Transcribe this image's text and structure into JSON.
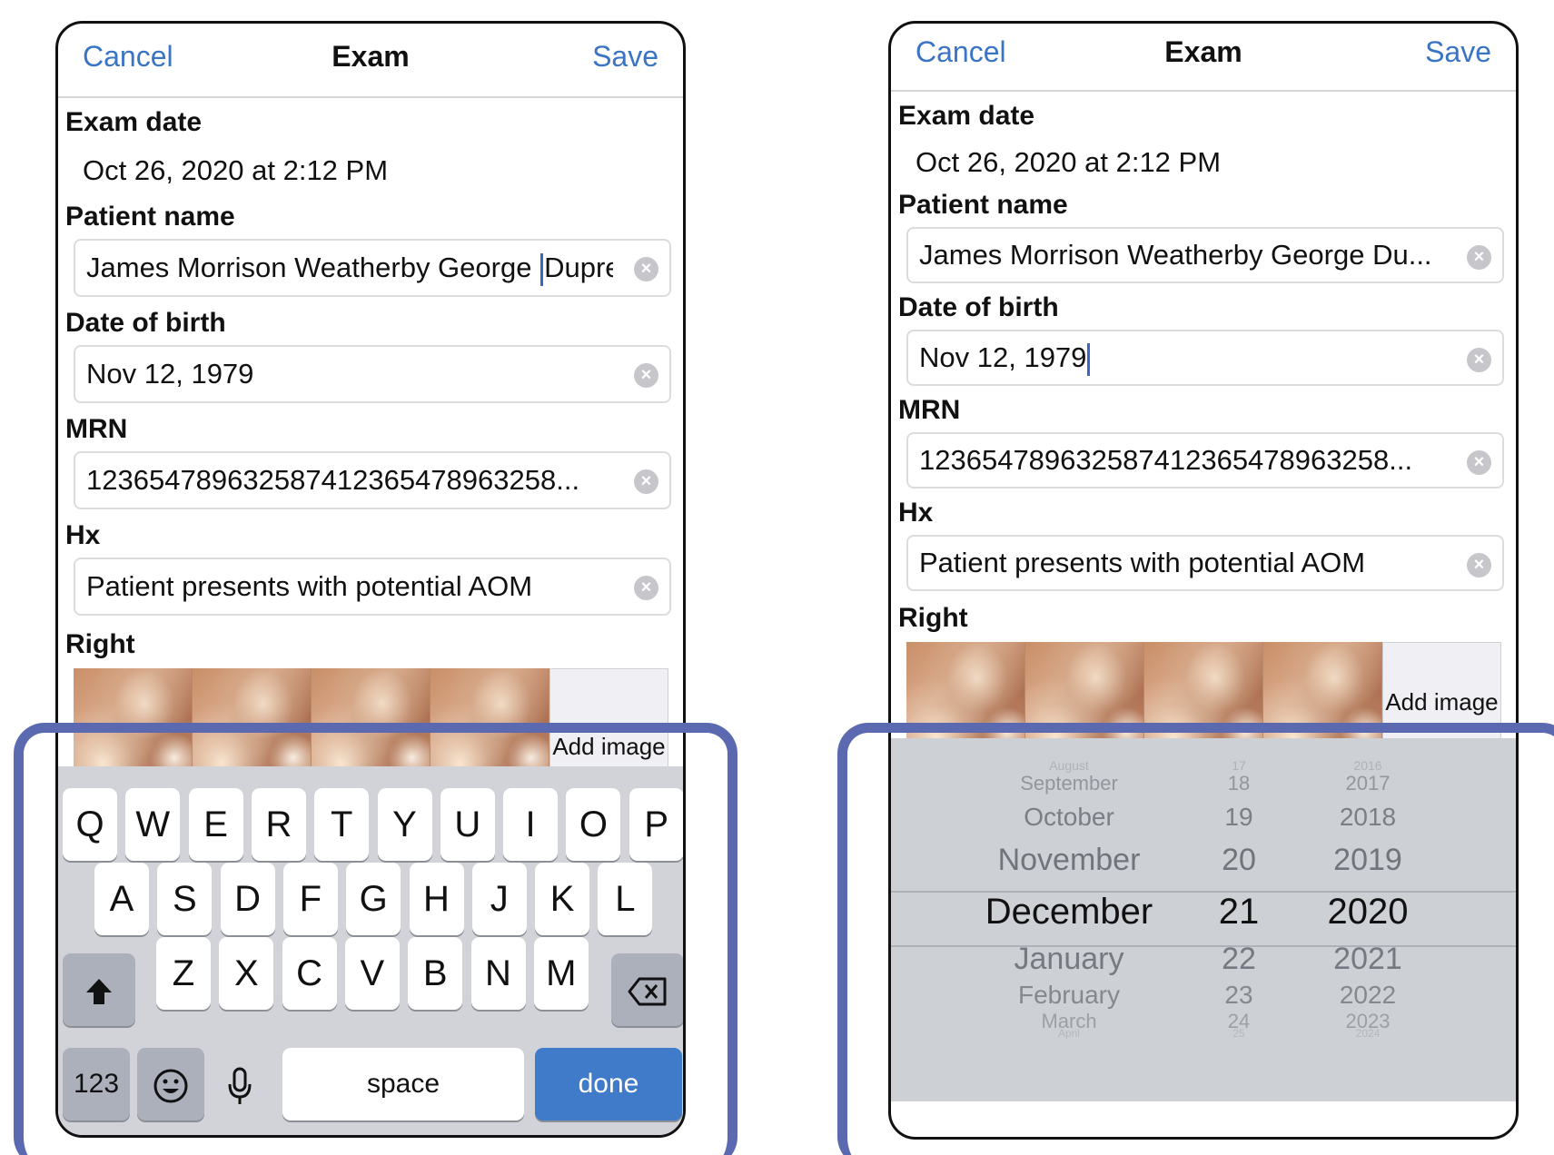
{
  "screens": {
    "left": {
      "nav": {
        "cancel": "Cancel",
        "title": "Exam",
        "save": "Save"
      },
      "exam_date_label": "Exam date",
      "exam_date_value": "Oct 26, 2020 at 2:12 PM",
      "patient_name_label": "Patient name",
      "patient_name_value_a": "James Morrison Weatherby George ",
      "patient_name_value_b": "Dupre",
      "dob_label": "Date of birth",
      "dob_value": "Nov 12, 1979",
      "mrn_label": "MRN",
      "mrn_value": "12365478963258741236547896325​8...",
      "hx_label": "Hx",
      "hx_value": "Patient presents with potential AOM",
      "right_label": "Right",
      "add_image": "Add image"
    },
    "right": {
      "nav": {
        "cancel": "Cancel",
        "title": "Exam",
        "save": "Save"
      },
      "exam_date_label": "Exam date",
      "exam_date_value": "Oct 26, 2020 at 2:12 PM",
      "patient_name_label": "Patient name",
      "patient_name_value": "James Morrison Weatherby George Du...",
      "dob_label": "Date of birth",
      "dob_value": "Nov 12, 1979",
      "mrn_label": "MRN",
      "mrn_value": "12365478963258741236547896325​8...",
      "hx_label": "Hx",
      "hx_value": "Patient presents with potential AOM",
      "right_label": "Right",
      "add_image": "Add image"
    }
  },
  "keyboard": {
    "row1": [
      "Q",
      "W",
      "E",
      "R",
      "T",
      "Y",
      "U",
      "I",
      "O",
      "P"
    ],
    "row2": [
      "A",
      "S",
      "D",
      "F",
      "G",
      "H",
      "J",
      "K",
      "L"
    ],
    "row3": [
      "Z",
      "X",
      "C",
      "V",
      "B",
      "N",
      "M"
    ],
    "numbers": "123",
    "space": "space",
    "done": "done"
  },
  "picker": {
    "months": [
      "August",
      "September",
      "October",
      "November",
      "December",
      "January",
      "February",
      "March",
      "April"
    ],
    "days": [
      "17",
      "18",
      "19",
      "20",
      "21",
      "22",
      "23",
      "24",
      "25"
    ],
    "years": [
      "2016",
      "2017",
      "2018",
      "2019",
      "2020",
      "2021",
      "2022",
      "2023",
      "2024"
    ],
    "selected_month": "December",
    "selected_day": "21",
    "selected_year": "2020"
  },
  "colors": {
    "accent": "#3a74c4",
    "frame": "#5b6ab0",
    "done_key": "#3f7bc9"
  }
}
